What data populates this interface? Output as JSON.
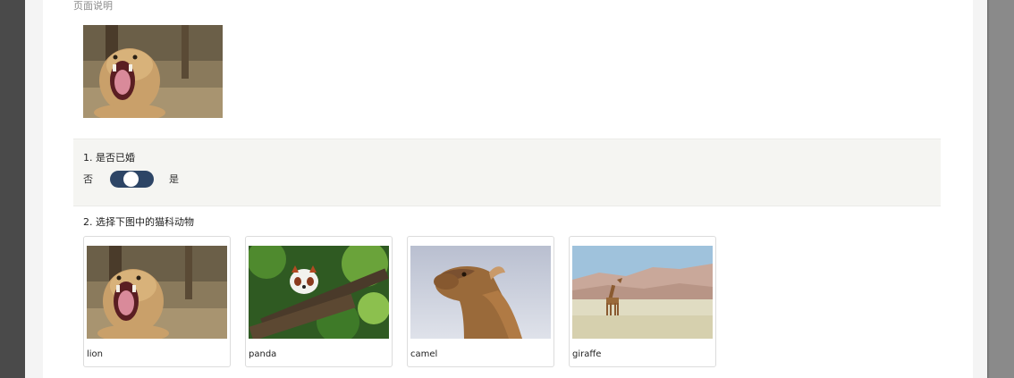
{
  "page": {
    "description": "页面说明"
  },
  "question1": {
    "title": "1. 是否已婚",
    "option_no": "否",
    "option_yes": "是"
  },
  "question2": {
    "title": "2. 选择下图中的猫科动物",
    "options": [
      {
        "label": "lion",
        "icon": "lion-photo"
      },
      {
        "label": "panda",
        "icon": "red-panda-photo"
      },
      {
        "label": "camel",
        "icon": "camel-photo"
      },
      {
        "label": "giraffe",
        "icon": "giraffe-photo"
      }
    ]
  },
  "colors": {
    "toggle_track": "#2d4566",
    "question_bg": "#f5f5f2"
  }
}
